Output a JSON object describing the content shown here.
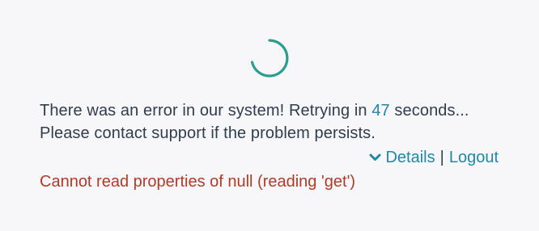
{
  "loader": {
    "icon": "loading-spinner-icon",
    "color": "#2a9d8f"
  },
  "message": {
    "line1_prefix": "There was an error in our system! Retrying in ",
    "countdown": "47",
    "line1_suffix": " seconds...",
    "line2": "Please contact support if the problem persists."
  },
  "actions": {
    "details_label": "Details",
    "separator": "|",
    "logout_label": "Logout",
    "details_icon": "chevron-down-icon"
  },
  "error": {
    "text": "Cannot read properties of null (reading 'get')"
  },
  "colors": {
    "text": "#2f3d4e",
    "link": "#1f87a8",
    "error": "#b23b25",
    "background": "#f7f7f9"
  }
}
